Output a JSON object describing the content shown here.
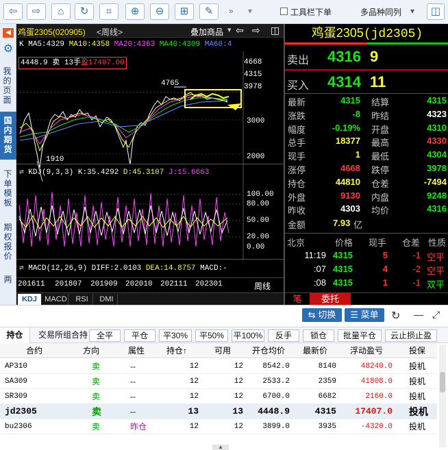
{
  "toolbar": {
    "checkbox_label": "工具栏下单",
    "dropdown_label": "多品种同列"
  },
  "leftnav": {
    "items": [
      "我的页面",
      "国内期货",
      "下单模板",
      "期权报价",
      "两"
    ]
  },
  "chart": {
    "title": "鸡蛋2305(020905)",
    "period": "<周线>",
    "overlay_label": "叠加商品",
    "ma_row": {
      "k": "K",
      "ma5": "MA5:4329",
      "ma10": "MA10:4358",
      "ma20": "MA20:4363",
      "ma40": "MA40:4309",
      "ma60": "MA60:4"
    },
    "position_info": {
      "price": "4448.9",
      "side": "卖",
      "qty": "13手",
      "pnl": "盈17407.00"
    },
    "high_label": "4765",
    "low_label": "1910",
    "price_ticks": [
      "4668",
      "4315",
      "3978",
      "3000",
      "2000"
    ],
    "kdj_label": "KDJ(9,3,3)",
    "kdj_k": "K:35.4292",
    "kdj_d": "D:45.3107",
    "kdj_j": "J:15.6663",
    "kdj_ticks": [
      "100.00",
      "80.00",
      "50.00",
      "20.00",
      "0.00"
    ],
    "macd_label": "MACD(12,26,9)",
    "macd_diff": "DIFF:2.0103",
    "macd_dea": "DEA:14.8757",
    "macd_macd": "MACD:-",
    "date_ticks": [
      "201611",
      "201807",
      "201909",
      "202010",
      "202111",
      "202301"
    ],
    "period_label": "周线",
    "tabs": [
      "KDJ",
      "MACD",
      "RSI",
      "DMI"
    ]
  },
  "quote": {
    "name": "鸡蛋2305",
    "code": "(jd2305)",
    "sell_label": "卖出",
    "sell_price": "4316",
    "sell_qty": "9",
    "buy_label": "买入",
    "buy_price": "4314",
    "buy_qty": "11",
    "stats": [
      {
        "l1": "最新",
        "v1": "4315",
        "c1": "green",
        "l2": "结算",
        "v2": "4315",
        "c2": "green"
      },
      {
        "l1": "涨跌",
        "v1": "-8",
        "c1": "green",
        "l2": "昨结",
        "v2": "4323",
        "c2": "wht"
      },
      {
        "l1": "幅度",
        "v1": "-0.19%",
        "c1": "green",
        "l2": "开盘",
        "v2": "4310",
        "c2": "green"
      },
      {
        "l1": "总手",
        "v1": "18377",
        "c1": "yel",
        "l2": "最高",
        "v2": "4330",
        "c2": "red"
      },
      {
        "l1": "现手",
        "v1": "1",
        "c1": "yel",
        "l2": "最低",
        "v2": "4304",
        "c2": "green"
      },
      {
        "l1": "涨停",
        "v1": "4668",
        "c1": "red",
        "l2": "跌停",
        "v2": "3978",
        "c2": "green"
      },
      {
        "l1": "持仓",
        "v1": "44810",
        "c1": "yel",
        "l2": "仓差",
        "v2": "-7494",
        "c2": "yel"
      },
      {
        "l1": "外盘",
        "v1": "9130",
        "c1": "red",
        "l2": "内盘",
        "v2": "9248",
        "c2": "green"
      },
      {
        "l1": "昨收",
        "v1": "4303",
        "c1": "wht",
        "l2": "均价",
        "v2": "4316",
        "c2": "green"
      }
    ],
    "amount_label": "金额",
    "amount_value": "7.93",
    "amount_unit": "亿",
    "ticks_header": {
      "loc": "北京",
      "price": "价格",
      "vol": "现手",
      "oi": "仓差",
      "nature": "性质"
    },
    "ticks": [
      {
        "time": "11:19",
        "price": "4315",
        "vol": "5",
        "oi": "-1",
        "nature": "空平"
      },
      {
        "time": ":07",
        "price": "4315",
        "vol": "4",
        "oi": "-2",
        "nature": "空平"
      },
      {
        "time": ":08",
        "price": "4315",
        "vol": "1",
        "oi": "-1",
        "nature": "双平"
      }
    ],
    "bottom_tabs": [
      "笔",
      "委托"
    ]
  },
  "lowbar": {
    "switch_label": "切换",
    "menu_label": "菜单"
  },
  "position_tabs": {
    "labels": [
      "持仓",
      "交易所组合持",
      "全平",
      "平仓",
      "平30%",
      "平50%",
      "平100%",
      "反手",
      "锁仓",
      "批量平仓",
      "云止损止盈"
    ]
  },
  "table": {
    "headers": [
      "合约",
      "方向",
      "属性",
      "持仓↑",
      "可用",
      "开仓均价",
      "最新价",
      "浮动盈亏",
      "投保"
    ],
    "rows": [
      {
        "contract": "AP310",
        "dir": "卖",
        "attr": "--",
        "hold": "12",
        "avail": "12",
        "open": "8542.0",
        "last": "8140",
        "pnl": "48240.0",
        "hedge": "投机"
      },
      {
        "contract": "SA309",
        "dir": "卖",
        "attr": "--",
        "hold": "12",
        "avail": "12",
        "open": "2533.2",
        "last": "2359",
        "pnl": "41808.0",
        "hedge": "投机"
      },
      {
        "contract": "SR309",
        "dir": "卖",
        "attr": "--",
        "hold": "12",
        "avail": "12",
        "open": "6700.0",
        "last": "6682",
        "pnl": "2160.0",
        "hedge": "投机"
      },
      {
        "contract": "jd2305",
        "dir": "卖",
        "attr": "--",
        "hold": "13",
        "avail": "13",
        "open": "4448.9",
        "last": "4315",
        "pnl": "17407.0",
        "hedge": "投机"
      },
      {
        "contract": "bu2306",
        "dir": "卖",
        "attr": "昨仓",
        "hold": "12",
        "avail": "12",
        "open": "3899.0",
        "last": "3935",
        "pnl": "-4320.0",
        "hedge": "投机"
      }
    ]
  },
  "colors": {
    "up": "#ff3a3a",
    "down": "#16e80e",
    "accent": "#ffff33",
    "brand": "#2a6db4"
  }
}
